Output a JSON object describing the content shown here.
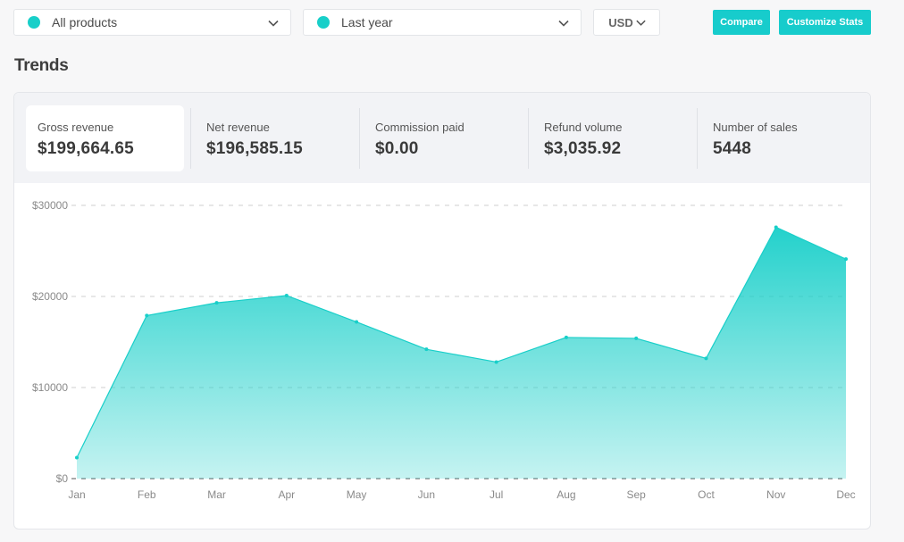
{
  "colors": {
    "accent": "#18cfc9",
    "button": "#17cccc",
    "grid": "#cfcfcf"
  },
  "filters": {
    "products": {
      "label": "All products",
      "icon": "chevron-down-icon"
    },
    "period": {
      "label": "Last year",
      "icon": "chevron-down-icon"
    },
    "currency": {
      "label": "USD",
      "icon": "chevron-down-icon"
    }
  },
  "actions": {
    "compare": "Compare",
    "customize": "Customize Stats"
  },
  "section_title": "Trends",
  "stats": [
    {
      "label": "Gross revenue",
      "value": "$199,664.65",
      "active": true
    },
    {
      "label": "Net revenue",
      "value": "$196,585.15",
      "active": false
    },
    {
      "label": "Commission paid",
      "value": "$0.00",
      "active": false
    },
    {
      "label": "Refund volume",
      "value": "$3,035.92",
      "active": false
    },
    {
      "label": "Number of sales",
      "value": "5448",
      "active": false
    }
  ],
  "chart_data": {
    "type": "area",
    "categories": [
      "Jan",
      "Feb",
      "Mar",
      "Apr",
      "May",
      "Jun",
      "Jul",
      "Aug",
      "Sep",
      "Oct",
      "Nov",
      "Dec"
    ],
    "values": [
      2300,
      17900,
      19300,
      20100,
      17200,
      14200,
      12800,
      15500,
      15400,
      13200,
      27600,
      24100
    ],
    "ylim": [
      0,
      30000
    ],
    "yticks": [
      0,
      10000,
      20000,
      30000
    ],
    "ytick_labels": [
      "$0",
      "$10000",
      "$20000",
      "$30000"
    ],
    "grid": true,
    "title": "",
    "xlabel": "",
    "ylabel": ""
  }
}
